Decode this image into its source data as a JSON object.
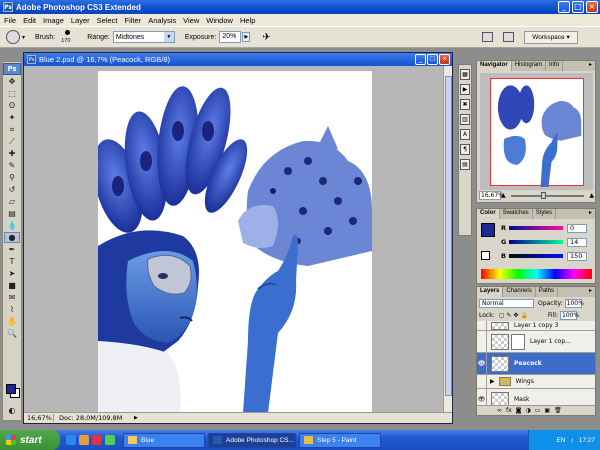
{
  "app": {
    "title": "Adobe Photoshop CS3 Extended",
    "logo": "Ps"
  },
  "menu": [
    "File",
    "Edit",
    "Image",
    "Layer",
    "Select",
    "Filter",
    "Analysis",
    "View",
    "Window",
    "Help"
  ],
  "options": {
    "brush_label": "Brush:",
    "brush_size": "170",
    "range_label": "Range:",
    "range_value": "Midtones",
    "exposure_label": "Exposure:",
    "exposure_value": "20%",
    "workspace_label": "Workspace ▾"
  },
  "document": {
    "title": "Blue 2.psd @ 16,7% (Peacock, RGB/8)",
    "zoom": "16,67%",
    "doc_info": "Doc: 28,0M/109,8M"
  },
  "navigator": {
    "tabs": [
      "Navigator",
      "Histogram",
      "Info"
    ],
    "zoom": "16,67%"
  },
  "color_panel": {
    "tabs": [
      "Color",
      "Swatches",
      "Styles"
    ],
    "r_label": "R",
    "r_value": "0",
    "g_label": "G",
    "g_value": "14",
    "b_label": "B",
    "b_value": "150",
    "foreground": "#000E96"
  },
  "layers_panel": {
    "tabs": [
      "Layers",
      "Channels",
      "Paths"
    ],
    "blend_mode": "Normal",
    "opacity_label": "Opacity:",
    "opacity_value": "100%",
    "lock_label": "Lock:",
    "fill_label": "Fill:",
    "fill_value": "100%",
    "layers": [
      {
        "name": "Layer 1 copy 3"
      },
      {
        "name": "Layer 1 cop..."
      },
      {
        "name": "Peacock"
      },
      {
        "name": "Wings"
      },
      {
        "name": "Mask"
      }
    ]
  },
  "taskbar": {
    "start_label": "start",
    "tasks": [
      "Blue",
      "Adobe Photoshop CS...",
      "Step 5 - Paint"
    ],
    "lang": "EN",
    "clock": "17:27"
  }
}
